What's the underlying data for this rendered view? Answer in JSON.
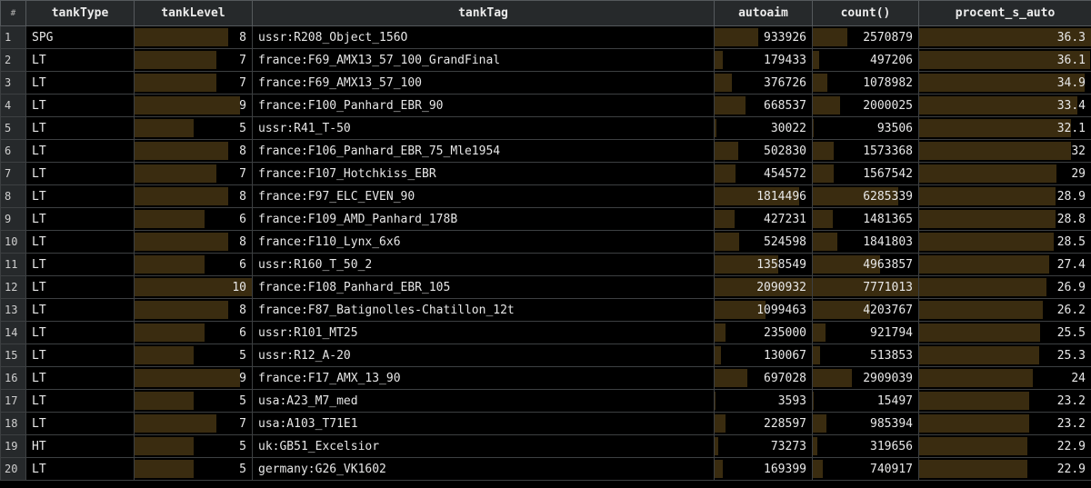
{
  "header": {
    "rownum": "#",
    "columns": [
      "tankType",
      "tankLevel",
      "tankTag",
      "autoaim",
      "count()",
      "procent_s_auto"
    ]
  },
  "colors": {
    "bar": "#3a2c10",
    "header_bg": "#26292b",
    "background": "#000000"
  },
  "rows": [
    {
      "n": "1",
      "tankType": "SPG",
      "tankLevel": "8",
      "tankTag": "ussr:R208_Object_156O",
      "autoaim": "933926",
      "count": "2570879",
      "procent": "36.3"
    },
    {
      "n": "2",
      "tankType": "LT",
      "tankLevel": "7",
      "tankTag": "france:F69_AMX13_57_100_GrandFinal",
      "autoaim": "179433",
      "count": "497206",
      "procent": "36.1"
    },
    {
      "n": "3",
      "tankType": "LT",
      "tankLevel": "7",
      "tankTag": "france:F69_AMX13_57_100",
      "autoaim": "376726",
      "count": "1078982",
      "procent": "34.9"
    },
    {
      "n": "4",
      "tankType": "LT",
      "tankLevel": "9",
      "tankTag": "france:F100_Panhard_EBR_90",
      "autoaim": "668537",
      "count": "2000025",
      "procent": "33.4"
    },
    {
      "n": "5",
      "tankType": "LT",
      "tankLevel": "5",
      "tankTag": "ussr:R41_T-50",
      "autoaim": "30022",
      "count": "93506",
      "procent": "32.1"
    },
    {
      "n": "6",
      "tankType": "LT",
      "tankLevel": "8",
      "tankTag": "france:F106_Panhard_EBR_75_Mle1954",
      "autoaim": "502830",
      "count": "1573368",
      "procent": "32"
    },
    {
      "n": "7",
      "tankType": "LT",
      "tankLevel": "7",
      "tankTag": "france:F107_Hotchkiss_EBR",
      "autoaim": "454572",
      "count": "1567542",
      "procent": "29"
    },
    {
      "n": "8",
      "tankType": "LT",
      "tankLevel": "8",
      "tankTag": "france:F97_ELC_EVEN_90",
      "autoaim": "1814496",
      "count": "6285339",
      "procent": "28.9"
    },
    {
      "n": "9",
      "tankType": "LT",
      "tankLevel": "6",
      "tankTag": "france:F109_AMD_Panhard_178B",
      "autoaim": "427231",
      "count": "1481365",
      "procent": "28.8"
    },
    {
      "n": "10",
      "tankType": "LT",
      "tankLevel": "8",
      "tankTag": "france:F110_Lynx_6x6",
      "autoaim": "524598",
      "count": "1841803",
      "procent": "28.5"
    },
    {
      "n": "11",
      "tankType": "LT",
      "tankLevel": "6",
      "tankTag": "ussr:R160_T_50_2",
      "autoaim": "1358549",
      "count": "4963857",
      "procent": "27.4"
    },
    {
      "n": "12",
      "tankType": "LT",
      "tankLevel": "10",
      "tankTag": "france:F108_Panhard_EBR_105",
      "autoaim": "2090932",
      "count": "7771013",
      "procent": "26.9"
    },
    {
      "n": "13",
      "tankType": "LT",
      "tankLevel": "8",
      "tankTag": "france:F87_Batignolles-Chatillon_12t",
      "autoaim": "1099463",
      "count": "4203767",
      "procent": "26.2"
    },
    {
      "n": "14",
      "tankType": "LT",
      "tankLevel": "6",
      "tankTag": "ussr:R101_MT25",
      "autoaim": "235000",
      "count": "921794",
      "procent": "25.5"
    },
    {
      "n": "15",
      "tankType": "LT",
      "tankLevel": "5",
      "tankTag": "ussr:R12_A-20",
      "autoaim": "130067",
      "count": "513853",
      "procent": "25.3"
    },
    {
      "n": "16",
      "tankType": "LT",
      "tankLevel": "9",
      "tankTag": "france:F17_AMX_13_90",
      "autoaim": "697028",
      "count": "2909039",
      "procent": "24"
    },
    {
      "n": "17",
      "tankType": "LT",
      "tankLevel": "5",
      "tankTag": "usa:A23_M7_med",
      "autoaim": "3593",
      "count": "15497",
      "procent": "23.2"
    },
    {
      "n": "18",
      "tankType": "LT",
      "tankLevel": "7",
      "tankTag": "usa:A103_T71E1",
      "autoaim": "228597",
      "count": "985394",
      "procent": "23.2"
    },
    {
      "n": "19",
      "tankType": "HT",
      "tankLevel": "5",
      "tankTag": "uk:GB51_Excelsior",
      "autoaim": "73273",
      "count": "319656",
      "procent": "22.9"
    },
    {
      "n": "20",
      "tankType": "LT",
      "tankLevel": "5",
      "tankTag": "germany:G26_VK1602",
      "autoaim": "169399",
      "count": "740917",
      "procent": "22.9"
    }
  ]
}
